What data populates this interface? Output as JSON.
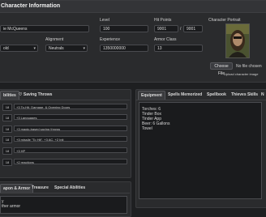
{
  "header": {
    "title": "Character Information"
  },
  "fields": {
    "name_value": "ie McQueens",
    "level_label": "Level",
    "level_value": "100",
    "hp_label": "Hit Points",
    "hp_current": "9001",
    "hp_sep": "/",
    "hp_max": "9001",
    "portrait_label": "Character Portrait",
    "class_value": "old",
    "alignment_label": "Alignment",
    "alignment_value": "Neutrals",
    "experience_label": "Experience",
    "experience_value": "1350000000",
    "ac_label": "Armor Class",
    "ac_value": "13"
  },
  "portrait": {
    "choose_file": "Choose File",
    "no_file": "No file chosen",
    "upload_label": "Upload character image"
  },
  "abilities_tabs": {
    "tab1": "bilities",
    "tab2": "Saving Throws"
  },
  "abilities_rows": [
    {
      "val": "18",
      "text": "+3 To-Hit, Damage, & Opening Doors"
    },
    {
      "val": "18",
      "text": "+3 Languages"
    },
    {
      "val": "18",
      "text": "+3 magic-based saving throws"
    },
    {
      "val": "18",
      "text": "+3 missile \"To Hit\", +3 AC, +2 Init"
    },
    {
      "val": "18",
      "text": "+3 HP"
    },
    {
      "val": "18",
      "text": "+2 reactions"
    }
  ],
  "equipment_tabs": {
    "t1": "Equipment",
    "t2": "Spells Memorized",
    "t3": "Spellbook",
    "t4": "Thieves Skills",
    "t5": "N"
  },
  "equipment_items": [
    "Torches: 6",
    "Tinder Box",
    "Tinder App",
    "Beer: 6 Gallons",
    "Towel"
  ],
  "weapons_tabs": {
    "t1": "apon & Armor",
    "t2": "Treasure",
    "t3": "Special Abilities"
  },
  "weapons_lines": [
    "y",
    "ther armor"
  ],
  "colors": {
    "background": "#1e1f21",
    "panel": "#2a2b2d",
    "accent": "#3a3b3e"
  }
}
